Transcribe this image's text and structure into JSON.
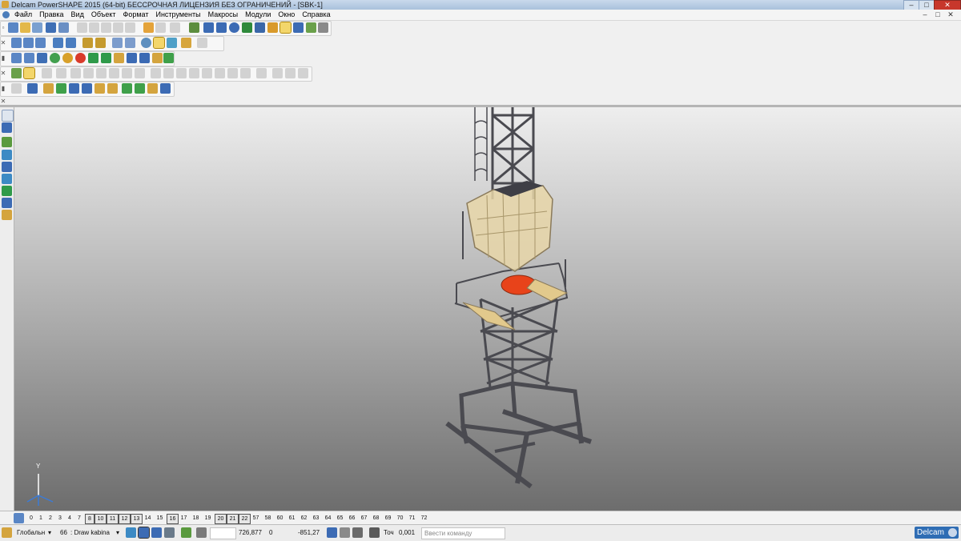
{
  "window": {
    "title": "Delcam PowerSHAPE 2015 (64-bit) БЕССРОЧНАЯ ЛИЦЕНЗИЯ БЕЗ ОГРАНИЧЕНИЙ - [SBK-1]",
    "minimize": "–",
    "maximize": "□",
    "close": "✕"
  },
  "menu": {
    "items": [
      "Файл",
      "Правка",
      "Вид",
      "Объект",
      "Формат",
      "Инструменты",
      "Макросы",
      "Модули",
      "Окно",
      "Справка"
    ],
    "mdi_min": "–",
    "mdi_max": "□",
    "mdi_close": "✕"
  },
  "toolbars": {
    "row1_grip": "▫",
    "row2_grip": "✕",
    "row3_grip": "▮",
    "row4_grip": "✕",
    "row5_grip": "▮",
    "row6_grip": "✕"
  },
  "viewport": {
    "axis_label_y": "Y",
    "background_top": "#eeeeee",
    "background_bottom": "#6d6d6d",
    "model_colors": {
      "steel": "#4a4a50",
      "cabin": "#e8d6a8",
      "platform": "#e2c98c",
      "motor": "#e8431a"
    }
  },
  "levels": [
    "0",
    "1",
    "2",
    "3",
    "4",
    "7",
    "8",
    "10",
    "11",
    "12",
    "13",
    "14",
    "15",
    "16",
    "17",
    "18",
    "19",
    "20",
    "21",
    "22",
    "57",
    "58",
    "60",
    "61",
    "62",
    "63",
    "64",
    "65",
    "66",
    "67",
    "68",
    "69",
    "70",
    "71",
    "72"
  ],
  "levels_boxed": [
    "8",
    "10",
    "11",
    "12",
    "13",
    "16",
    "20",
    "21",
    "22"
  ],
  "status": {
    "workplane": "Глобальн",
    "workplane_arrow": "▾",
    "level_number": "66",
    "level_name": ": Draw kabina",
    "level_arrow": "▾",
    "coord_x": "726,877",
    "coord_y": "0",
    "coord_z": "-851,27",
    "tolerance_label": "Точ",
    "tolerance_value": "0,001",
    "command_placeholder": "Ввести команду",
    "logo_text": "Delcam"
  }
}
